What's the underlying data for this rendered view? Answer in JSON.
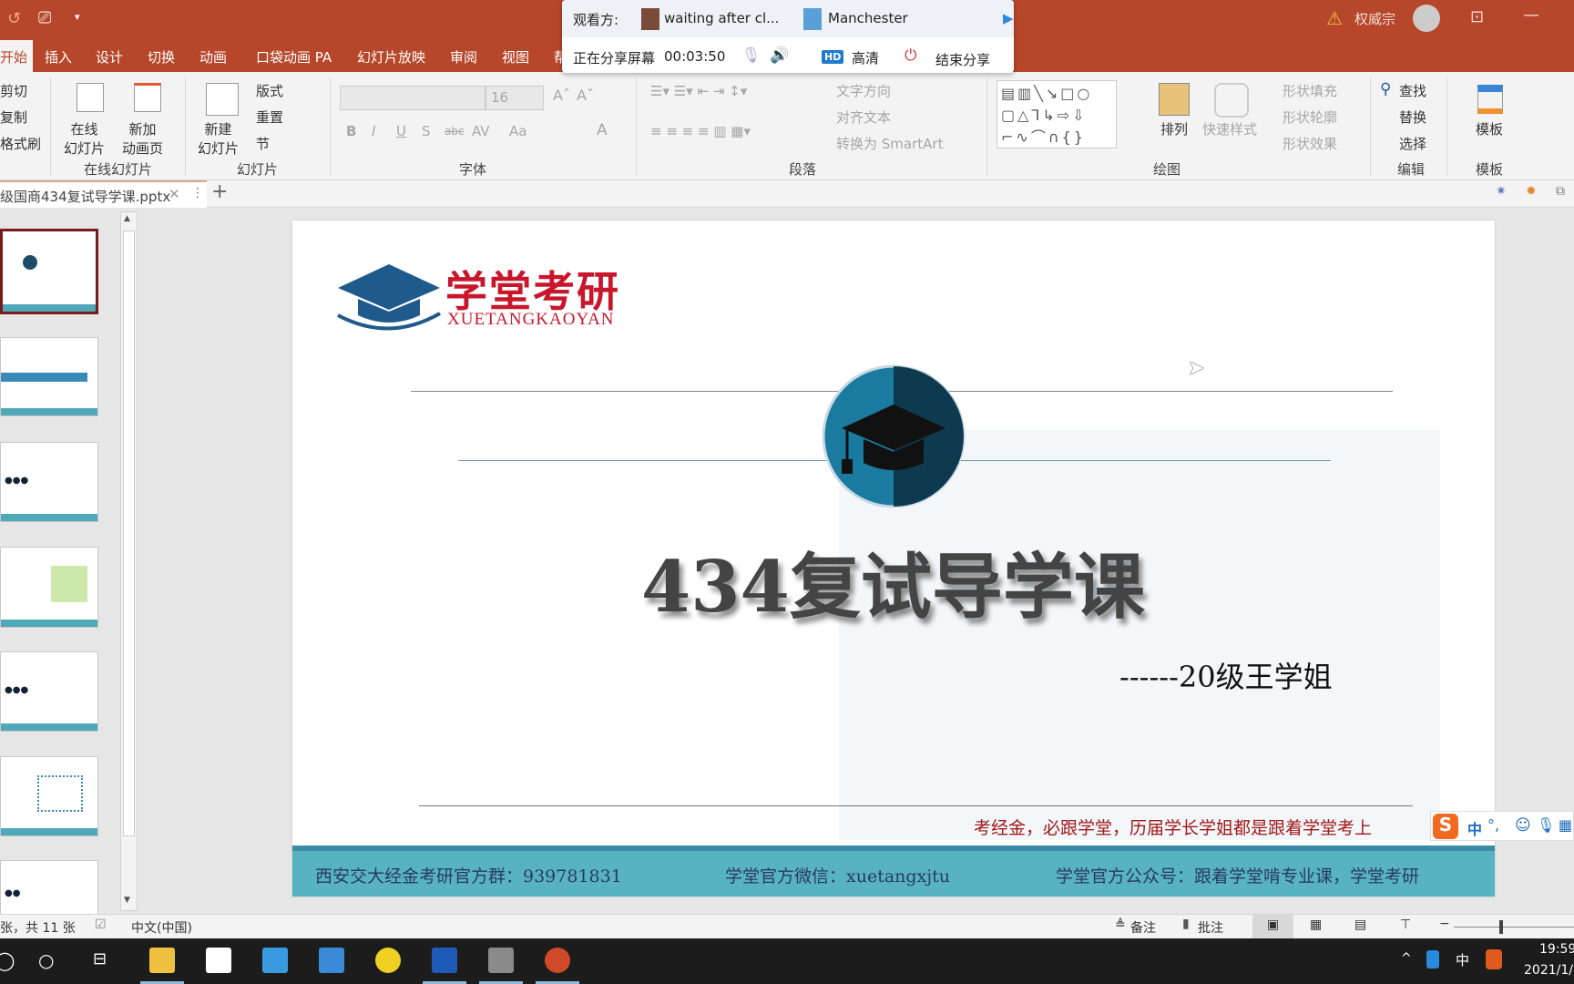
{
  "title_bar": {
    "user_name": "权威宗",
    "warning_icon": "warning-icon",
    "qat": [
      "undo-icon",
      "present-icon",
      "customize-icon"
    ]
  },
  "share_popup": {
    "viewers_label": "观看方:",
    "viewers": [
      "waiting after cl...",
      "Manchester"
    ],
    "sharing_label": "正在分享屏幕",
    "elapsed": "00:03:50",
    "quality_badge": "HD",
    "quality_label": "高清",
    "end_label": "结束分享"
  },
  "ribbon_tabs": [
    "开始",
    "插入",
    "设计",
    "切换",
    "动画",
    "口袋动画 PA",
    "幻灯片放映",
    "审阅",
    "视图",
    "帮"
  ],
  "ribbon": {
    "clipboard": {
      "cut": "剪切",
      "copy": "复制",
      "format_painter": "格式刷"
    },
    "online": {
      "online_slides": "在线\n幻灯片",
      "add_anim": "新加\n动画页",
      "group": "在线幻灯片"
    },
    "slides": {
      "new_slide": "新建\n幻灯片",
      "layout": "版式",
      "reset": "重置",
      "section": "节",
      "group": "幻灯片"
    },
    "font": {
      "size": "16",
      "group": "字体",
      "buttons": [
        "B",
        "I",
        "U",
        "S",
        "abc",
        "AV",
        "Aa",
        "A"
      ]
    },
    "paragraph": {
      "text_direction": "文字方向",
      "align_text": "对齐文本",
      "smartart": "转换为 SmartArt",
      "group": "段落"
    },
    "drawing": {
      "arrange": "排列",
      "quick_styles": "快速样式",
      "fill": "形状填充",
      "outline": "形状轮廓",
      "effects": "形状效果",
      "group": "绘图"
    },
    "editing": {
      "find": "查找",
      "replace": "替换",
      "select": "选择",
      "group": "编辑"
    },
    "templates": {
      "button": "模板",
      "group": "模板"
    }
  },
  "doc_tab": {
    "filename": "级国商434复试导学课.pptx"
  },
  "slide": {
    "logo_cn": "学堂考研",
    "logo_en": "XUETANGKAOYAN",
    "title": "434复试导学课",
    "subtitle": "------20级王学姐",
    "slogan": "考经金，必跟学堂，历届学长学姐都是跟着学堂考上",
    "footer": [
      "西安交大经金考研官方群：939781831",
      "学堂官方微信：xuetangxjtu",
      "学堂官方公众号：跟着学堂啃专业课，学堂考研"
    ]
  },
  "ime": {
    "mode": "中",
    "punct": "°,"
  },
  "status_bar": {
    "slide_count": "张，共 11 张",
    "language": "中文(中国)",
    "notes": "备注",
    "comments": "批注"
  },
  "taskbar": {
    "time": "19:59",
    "date": "2021/1/",
    "ime": "中"
  },
  "colors": {
    "accent": "#b7472a",
    "footer_band": "#57b3c0",
    "slogan": "#a01818",
    "logo_red": "#c8162b",
    "logo_blue": "#1e5a8c"
  }
}
